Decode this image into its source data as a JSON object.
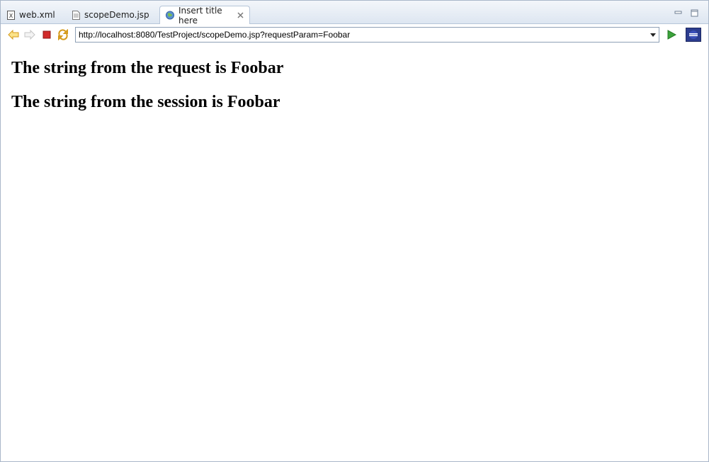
{
  "tabs": [
    {
      "label": "web.xml",
      "icon": "xml-file-icon"
    },
    {
      "label": "scopeDemo.jsp",
      "icon": "jsp-file-icon"
    },
    {
      "label": "Insert title here",
      "icon": "globe-icon",
      "active": true
    }
  ],
  "toolbar": {
    "icons": [
      "back-arrow-icon",
      "forward-arrow-icon",
      "stop-icon",
      "refresh-icon"
    ],
    "url": "http://localhost:8080/TestProject/scopeDemo.jsp?requestParam=Foobar",
    "go_icon": "go-play-icon",
    "eclipse_icon": "eclipse-logo-icon"
  },
  "page": {
    "line1": "The string from the request is Foobar",
    "line2": "The string from the session is Foobar"
  },
  "colors": {
    "tab_bar": "#dde6f1",
    "border": "#a9b7c9",
    "nav_arrow": "#f0b43a",
    "stop": "#d12b2b",
    "go": "#3ca33c"
  }
}
